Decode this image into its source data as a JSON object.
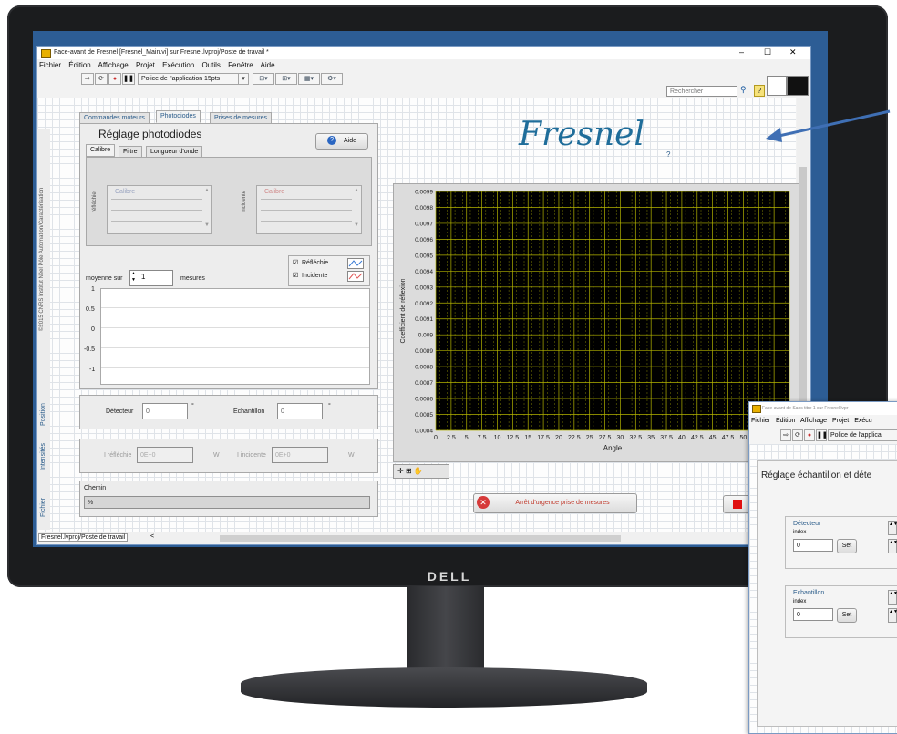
{
  "window": {
    "title": "Face-avant de Fresnel [Fresnel_Main.vi] sur Fresnel.lvproj/Poste de travail *",
    "menu": [
      "Fichier",
      "Édition",
      "Affichage",
      "Projet",
      "Exécution",
      "Outils",
      "Fenêtre",
      "Aide"
    ],
    "font_label": "Police de l'application 15pts",
    "search_placeholder": "Rechercher",
    "status_bar": "Fresnel.lvproj/Poste de travail"
  },
  "brand": {
    "logo": "Fresnel",
    "question": "?"
  },
  "copyright": "©2015 CNRS Institut Néel Pôle Automation/Caractérisation",
  "tabs": [
    "Commandes moteurs",
    "Photodiodes",
    "Prises de mesures"
  ],
  "photodiodes": {
    "title": "Réglage photodiodes",
    "help_button": "Aide",
    "subtabs": [
      "Calibre",
      "Filtre",
      "Longueur d'onde"
    ],
    "reflechie_label": "réfléchie",
    "incidente_label": "incidente",
    "calibre_left": "Calibre",
    "calibre_right": "Calibre",
    "legend": [
      "Réfléchie",
      "Incidente"
    ],
    "average_label": "moyenne sur",
    "average_value": "1",
    "average_unit": "mesures",
    "y_ticks": [
      "1",
      "0.5",
      "0",
      "-0.5",
      "-1"
    ]
  },
  "position": {
    "section": "Position",
    "detecteur_label": "Détecteur",
    "detecteur_value": "0",
    "echantillon_label": "Echantillon",
    "echantillon_value": "0",
    "unit": "°"
  },
  "intensites": {
    "section": "Intensités",
    "reflechie_label": "I réfléchie",
    "reflechie_value": "0E+0",
    "incidente_label": "I incidente",
    "incidente_value": "0E+0",
    "unit": "W"
  },
  "fichier": {
    "section": "Fichier",
    "chemin_label": "Chemin",
    "chemin_value": "%"
  },
  "stop_button": "Arrêt d'urgence prise de mesures",
  "chart_data": {
    "type": "line",
    "xlabel": "Angle",
    "ylabel": "Coefficient de réflexion",
    "x_ticks": [
      "0",
      "2.5",
      "5",
      "7.5",
      "10",
      "12.5",
      "15",
      "17.5",
      "20",
      "22.5",
      "25",
      "27.5",
      "30",
      "32.5",
      "35",
      "37.5",
      "40",
      "42.5",
      "45",
      "47.5",
      "50",
      "52.5",
      "55",
      "5"
    ],
    "y_ticks": [
      "0.0099",
      "0.0098",
      "0.0097",
      "0.0096",
      "0.0095",
      "0.0094",
      "0.0093",
      "0.0092",
      "0.0091",
      "0.009",
      "0.0089",
      "0.0088",
      "0.0087",
      "0.0086",
      "0.0085",
      "0.0084"
    ],
    "xlim": [
      0,
      57.5
    ],
    "ylim": [
      0.0084,
      0.0099
    ],
    "grid": true,
    "colors": {
      "plot_bg": "#000000",
      "grid": "#b3b300"
    },
    "series": []
  },
  "window2": {
    "title": "Face-avant de Sans titre 1 sur Fresnel.lvpr",
    "menu": [
      "Fichier",
      "Édition",
      "Affichage",
      "Projet",
      "Exécu"
    ],
    "font_label": "Police de l'applica",
    "heading": "Réglage échantillon et déte",
    "detecteur": {
      "label": "Détecteur",
      "index_label": "index",
      "value": "0",
      "set": "Set"
    },
    "echantillon": {
      "label": "Echantillon",
      "index_label": "index",
      "value": "0",
      "set": "Set"
    }
  },
  "monitor": {
    "brand": "DELL"
  }
}
